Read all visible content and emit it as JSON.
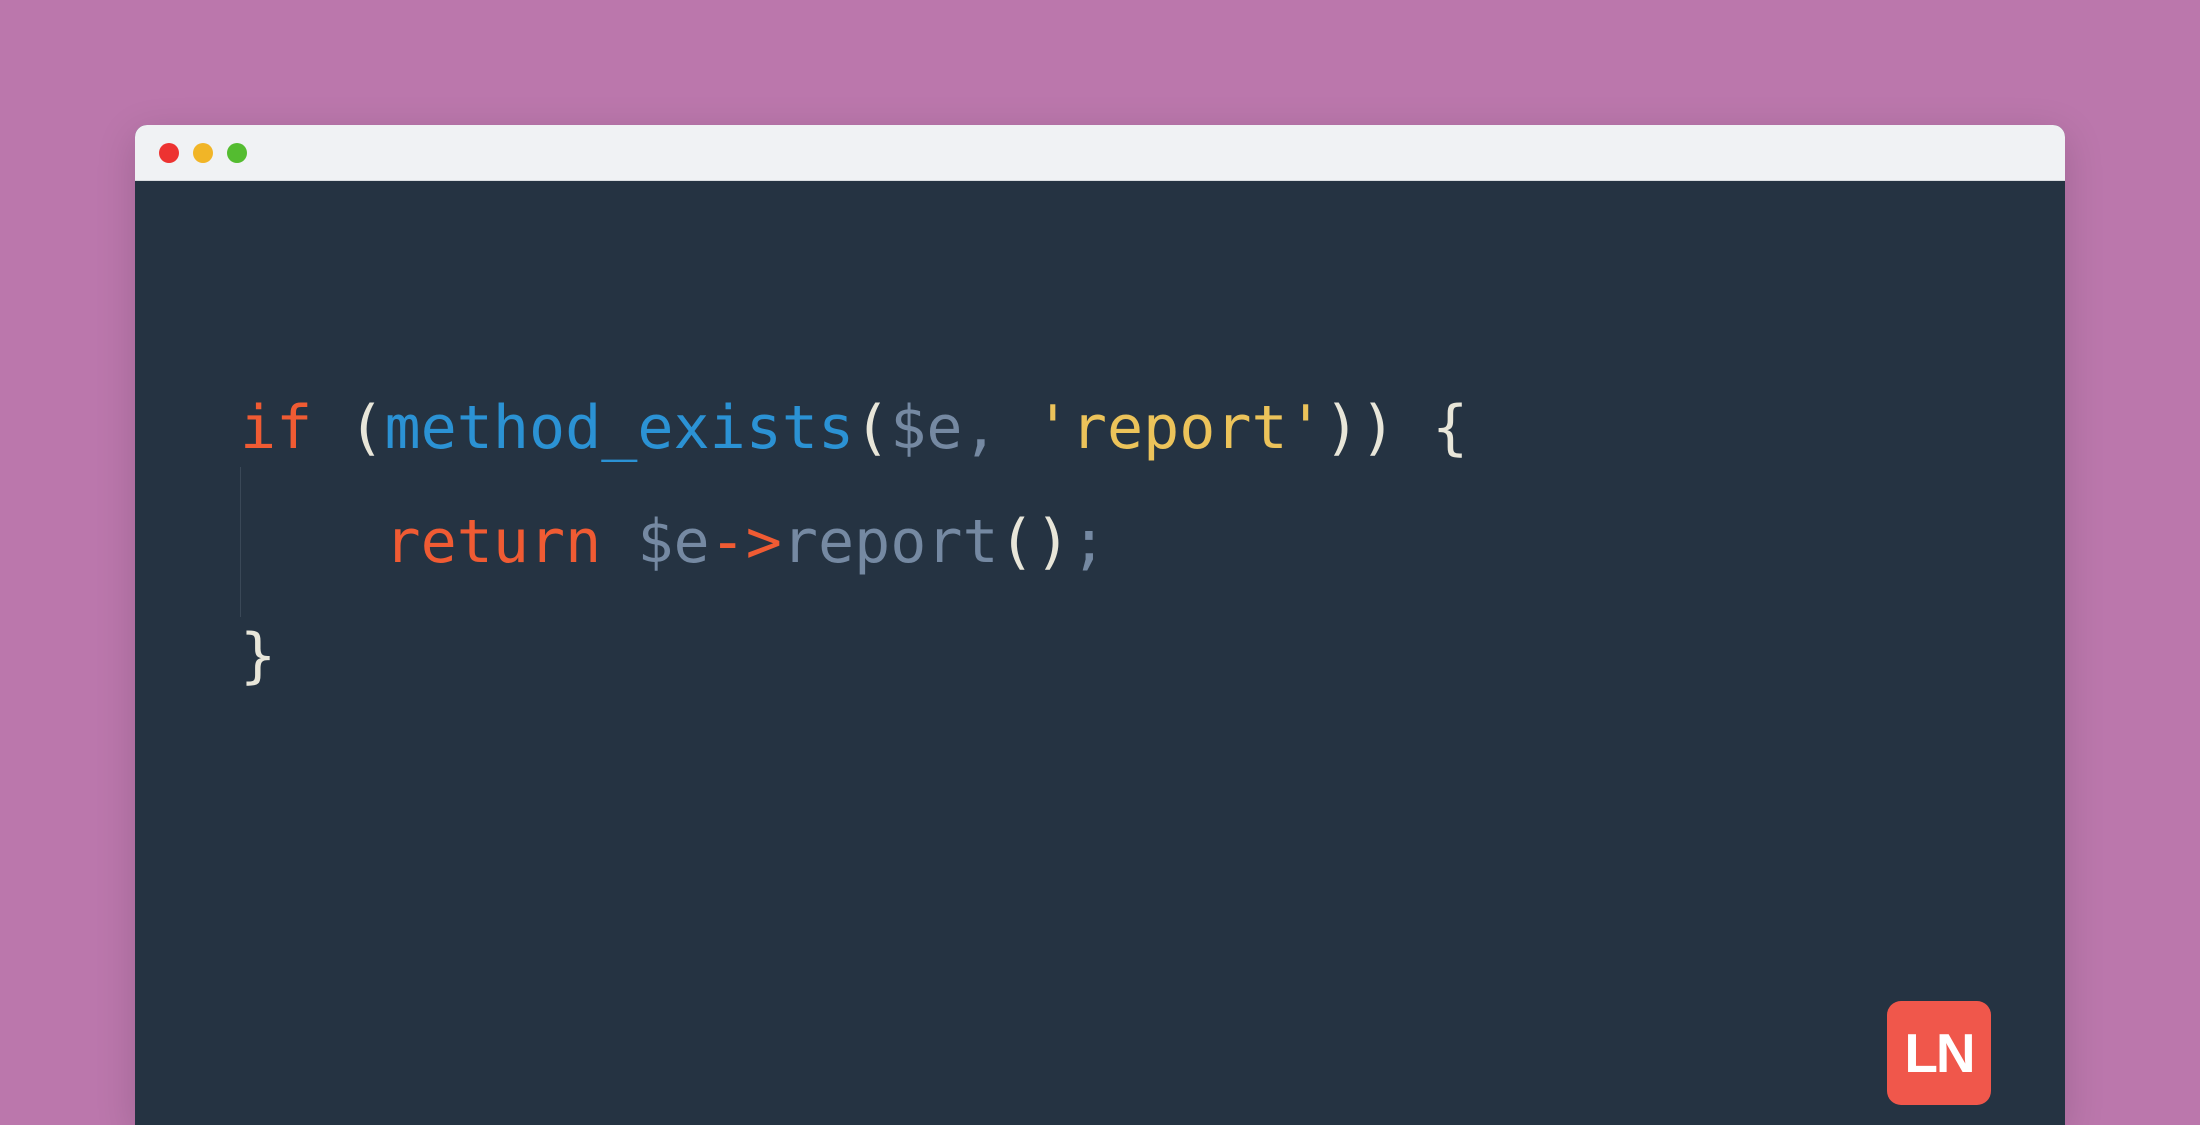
{
  "code": {
    "line1": {
      "if": "if",
      "sp1": " ",
      "lp1": "(",
      "func": "method_exists",
      "lp2": "(",
      "var": "$e",
      "comma": ",",
      "sp2": " ",
      "string": "'report'",
      "rp1": ")",
      "rp2": ")",
      "sp3": " ",
      "brace": "{"
    },
    "line2": {
      "indent": "    ",
      "return": "return",
      "sp1": " ",
      "var": "$e",
      "arrow": "->",
      "method": "report",
      "lp": "(",
      "rp": ")",
      "semi": ";"
    },
    "line3": {
      "brace": "}"
    }
  },
  "badge": {
    "text": "LN"
  },
  "colors": {
    "background": "#bb77ac",
    "editor_bg": "#253342",
    "titlebar": "#f0f2f4",
    "keyword": "#f05b33",
    "string": "#ecc35a",
    "function": "#2b92d4",
    "variable": "#7589a2",
    "punctuation": "#e8e6d9",
    "badge_bg": "#f0574b"
  }
}
